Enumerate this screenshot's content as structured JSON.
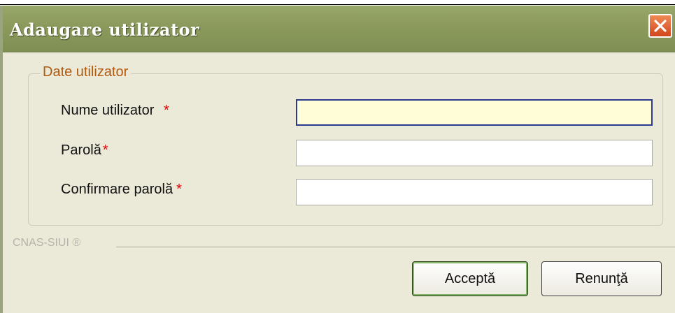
{
  "dialog": {
    "title": "Adaugare utilizator",
    "group_title": "Date utilizator",
    "fields": [
      {
        "label": "Nume utilizator",
        "required_mark": "*",
        "value": ""
      },
      {
        "label": "Parolă",
        "required_mark": "*",
        "value": ""
      },
      {
        "label": "Confirmare parolă",
        "required_mark": "*",
        "value": ""
      }
    ],
    "footer_brand": "CNAS-SIUI ®",
    "buttons": {
      "accept": "Acceptă",
      "cancel": "Renunţă"
    }
  },
  "colors": {
    "titlebar": "#8b9a5c",
    "dialog_bg": "#ebe9d8",
    "legend_text": "#b15a10",
    "required_mark": "#e00000",
    "focused_field_bg": "#fffdd8",
    "close_button": "#e05a2a"
  },
  "icons": {
    "close": "close-icon"
  }
}
